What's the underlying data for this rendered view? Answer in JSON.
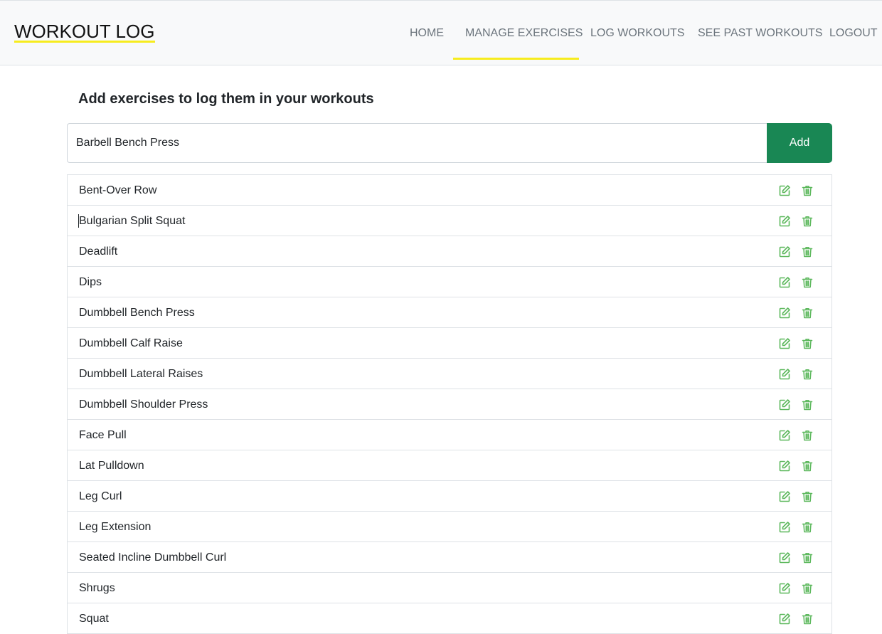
{
  "brand": "WORKOUT LOG",
  "nav": {
    "items": [
      {
        "label": "HOME"
      },
      {
        "label": "MANAGE EXERCISES",
        "active": true
      },
      {
        "label": "LOG WORKOUTS"
      },
      {
        "label": "SEE PAST WORKOUTS"
      },
      {
        "label": "LOGOUT"
      }
    ]
  },
  "colors": {
    "accent": "#f7ec1e",
    "add_button": "#198754",
    "icon_green": "#5cb85c"
  },
  "main": {
    "heading": "Add exercises to log them in your workouts",
    "input_value": "Barbell Bench Press",
    "add_label": "Add"
  },
  "exercises": [
    {
      "name": "Bent-Over Row"
    },
    {
      "name": "Bulgarian Split Squat"
    },
    {
      "name": "Deadlift"
    },
    {
      "name": "Dips"
    },
    {
      "name": "Dumbbell Bench Press"
    },
    {
      "name": "Dumbbell Calf Raise"
    },
    {
      "name": "Dumbbell Lateral Raises"
    },
    {
      "name": "Dumbbell Shoulder Press"
    },
    {
      "name": "Face Pull"
    },
    {
      "name": "Lat Pulldown"
    },
    {
      "name": "Leg Curl"
    },
    {
      "name": "Leg Extension"
    },
    {
      "name": "Seated Incline Dumbbell Curl"
    },
    {
      "name": "Shrugs"
    },
    {
      "name": "Squat"
    }
  ],
  "icons": {
    "edit": "edit-icon",
    "delete": "trash-icon"
  }
}
